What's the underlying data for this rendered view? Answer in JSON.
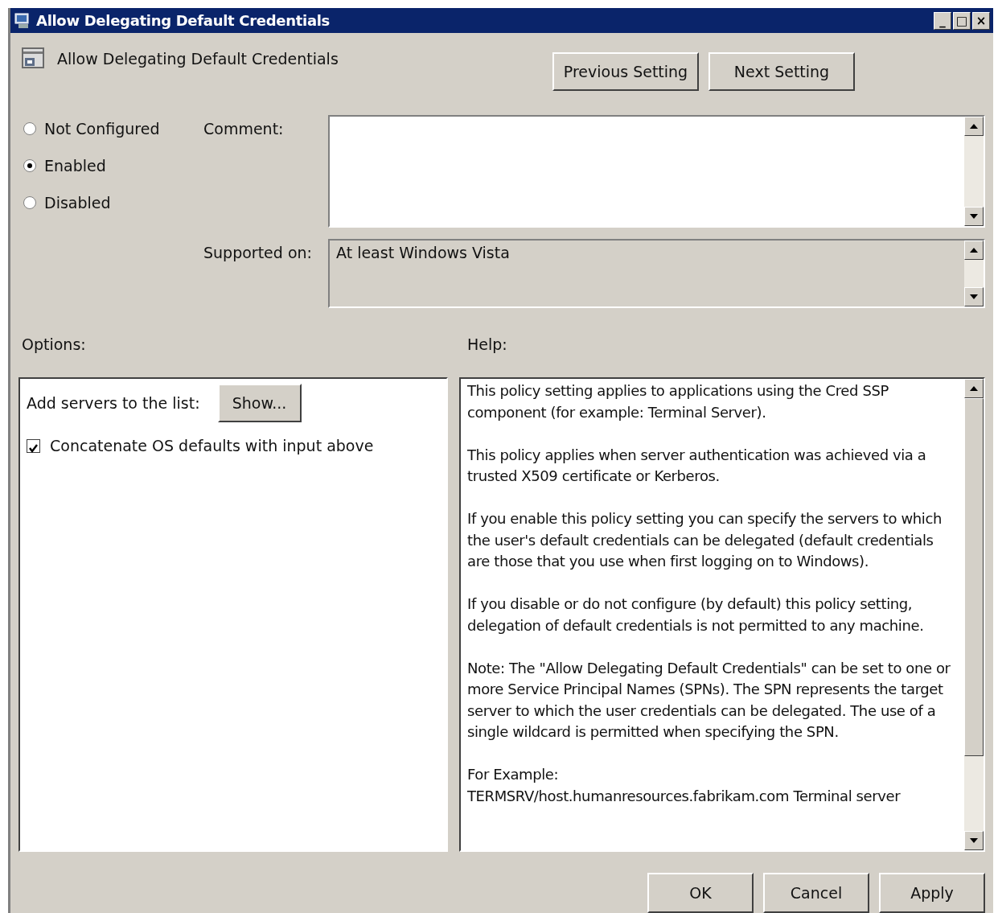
{
  "window": {
    "title": "Allow Delegating Default Credentials",
    "controls": [
      "_",
      "□",
      "×"
    ]
  },
  "header": {
    "policy_name": "Allow Delegating Default Credentials",
    "buttons": [
      "Previous Setting",
      "Next Setting"
    ]
  },
  "state_options": [
    {
      "label": "Not Configured",
      "selected": false
    },
    {
      "label": "Enabled",
      "selected": true
    },
    {
      "label": "Disabled",
      "selected": false
    }
  ],
  "comment": {
    "label": "Comment:"
  },
  "supported_on": {
    "label": "Supported on:",
    "value": "At least Windows Vista"
  },
  "options": {
    "label": "Options:",
    "list_label": "Add servers to the list:",
    "show_button": "Show...",
    "checkbox": {
      "label": "Concatenate OS defaults with input above",
      "checked": true
    }
  },
  "help": {
    "label": "Help:",
    "paragraphs": [
      "This policy setting applies to applications using the Cred SSP component (for example: Terminal Server).",
      "This policy applies when server authentication was achieved via a trusted X509 certificate or Kerberos.",
      "If you enable this policy setting you can specify the servers to which the user's default credentials can be delegated (default credentials are those that you use when first logging on to Windows).",
      "If you disable or do not configure (by default) this policy setting, delegation of default credentials is not permitted to any machine.",
      "Note: The \"Allow Delegating Default Credentials\" can be set to one or more Service Principal Names (SPNs).  The SPN represents the target server to which the user credentials can be delegated.  The use of a single wildcard is permitted when specifying the SPN.",
      "For Example:\nTERMSRV/host.humanresources.fabrikam.com Terminal server"
    ]
  },
  "footer_buttons": [
    "OK",
    "Cancel",
    "Apply"
  ]
}
